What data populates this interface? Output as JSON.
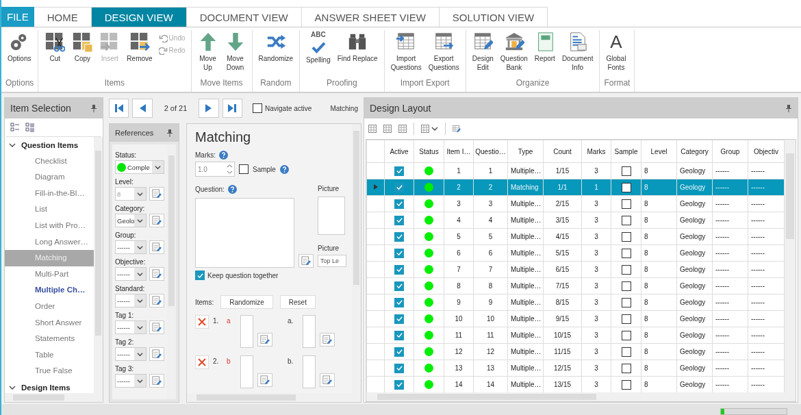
{
  "tabs": [
    {
      "label": "FILE",
      "kind": "file",
      "selected": false
    },
    {
      "label": "HOME",
      "kind": "tab",
      "selected": false
    },
    {
      "label": "DESIGN VIEW",
      "kind": "tab",
      "selected": true
    },
    {
      "label": "DOCUMENT VIEW",
      "kind": "tab",
      "selected": false
    },
    {
      "label": "ANSWER SHEET VIEW",
      "kind": "tab",
      "selected": false
    },
    {
      "label": "SOLUTION VIEW",
      "kind": "tab",
      "selected": false
    }
  ],
  "ribbon": {
    "groups": [
      {
        "label": "Options",
        "buttons": [
          {
            "label": "Options",
            "kind": "large",
            "disabled": false
          }
        ]
      },
      {
        "label": "Items",
        "buttons": [
          {
            "label": "Cut",
            "kind": "large",
            "disabled": false
          },
          {
            "label": "Copy",
            "kind": "large",
            "disabled": false
          },
          {
            "label": "Insert",
            "kind": "large",
            "disabled": true
          },
          {
            "label": "Remove",
            "kind": "large",
            "disabled": false
          },
          {
            "label": "Undo",
            "kind": "small",
            "disabled": true
          },
          {
            "label": "Redo",
            "kind": "small",
            "disabled": true
          }
        ]
      },
      {
        "label": "Move Items",
        "buttons": [
          {
            "label": "Move\nUp",
            "kind": "large",
            "disabled": false
          },
          {
            "label": "Move\nDown",
            "kind": "large",
            "disabled": false
          }
        ]
      },
      {
        "label": "Random",
        "buttons": [
          {
            "label": "Randomize",
            "kind": "large",
            "disabled": false
          }
        ]
      },
      {
        "label": "Proofing",
        "buttons": [
          {
            "label": "Spelling",
            "kind": "large",
            "disabled": false,
            "icon_text": "ABC"
          },
          {
            "label": "Find Replace",
            "kind": "large",
            "disabled": false
          }
        ]
      },
      {
        "label": "Import Export",
        "buttons": [
          {
            "label": "Import\nQuestions",
            "kind": "large",
            "disabled": false
          },
          {
            "label": "Export\nQuestions",
            "kind": "large",
            "disabled": false
          }
        ]
      },
      {
        "label": "Organize",
        "buttons": [
          {
            "label": "Design\nEdit",
            "kind": "large",
            "disabled": false
          },
          {
            "label": "Question\nBank",
            "kind": "large",
            "disabled": false
          },
          {
            "label": "Report",
            "kind": "large",
            "disabled": false
          },
          {
            "label": "Document\nInfo",
            "kind": "large",
            "disabled": false
          }
        ]
      },
      {
        "label": "Format",
        "buttons": [
          {
            "label": "Global\nFonts",
            "kind": "large",
            "disabled": false,
            "icon_text": "A"
          }
        ]
      }
    ]
  },
  "item_selection": {
    "title": "Item Selection",
    "tree": [
      {
        "label": "Question Items",
        "expanded": true,
        "children": [
          {
            "label": "Checklist",
            "selected": false,
            "current": false
          },
          {
            "label": "Diagram",
            "selected": false,
            "current": false
          },
          {
            "label": "Fill-in-the-Bl…",
            "selected": false,
            "current": false
          },
          {
            "label": "List",
            "selected": false,
            "current": false
          },
          {
            "label": "List with Pro…",
            "selected": false,
            "current": false
          },
          {
            "label": "Long Answer…",
            "selected": false,
            "current": false
          },
          {
            "label": "Matching",
            "selected": true,
            "current": false
          },
          {
            "label": "Multi-Part",
            "selected": false,
            "current": false
          },
          {
            "label": "Multiple Ch…",
            "selected": false,
            "current": true
          },
          {
            "label": "Order",
            "selected": false,
            "current": false
          },
          {
            "label": "Short Answer",
            "selected": false,
            "current": false
          },
          {
            "label": "Statements",
            "selected": false,
            "current": false
          },
          {
            "label": "Table",
            "selected": false,
            "current": false
          },
          {
            "label": "True False",
            "selected": false,
            "current": false
          }
        ]
      },
      {
        "label": "Design Items",
        "expanded": true
      }
    ]
  },
  "navigator": {
    "position": "2 of 21",
    "navigate_active": {
      "label": "Navigate active",
      "checked": false
    },
    "item_type": "Matching"
  },
  "references": {
    "title": "References",
    "fields": [
      {
        "label": "Status:",
        "value": "Comple",
        "kind": "status",
        "color": "#00e400",
        "disabled": false
      },
      {
        "label": "Level:",
        "value": "8",
        "kind": "select",
        "disabled": true
      },
      {
        "label": "Category:",
        "value": "Geolo",
        "kind": "select",
        "disabled": false
      },
      {
        "label": "Group:",
        "value": "------",
        "kind": "select",
        "disabled": false
      },
      {
        "label": "Objective:",
        "value": "------",
        "kind": "select",
        "disabled": false
      },
      {
        "label": "Standard:",
        "value": "------",
        "kind": "select",
        "disabled": false
      },
      {
        "label": "Tag 1:",
        "value": "------",
        "kind": "select",
        "disabled": false
      },
      {
        "label": "Tag 2:",
        "value": "------",
        "kind": "select",
        "disabled": false
      },
      {
        "label": "Tag 3:",
        "value": "------",
        "kind": "select",
        "disabled": false
      }
    ]
  },
  "editor": {
    "title": "Matching",
    "marks_label": "Marks:",
    "marks_value": "1.0",
    "sample": {
      "label": "Sample",
      "checked": false
    },
    "question_label": "Question:",
    "picture_label": "Picture",
    "picture_position_label": "Picture",
    "picture_position_value": "Top Le",
    "keep_together": {
      "label": "Keep question together",
      "checked": true
    },
    "items_label": "Items:",
    "buttons": [
      "Randomize",
      "Reset"
    ],
    "items": [
      {
        "number": "1.",
        "letter": "a",
        "match_letter": "a."
      },
      {
        "number": "2.",
        "letter": "b",
        "match_letter": "b."
      }
    ]
  },
  "design_layout": {
    "title": "Design Layout",
    "columns": [
      "Active",
      "Status",
      "Item I…",
      "Questio…",
      "Type",
      "Count",
      "Marks",
      "Sample",
      "Level",
      "Category",
      "Group",
      "Objectiv"
    ],
    "rows": [
      {
        "selected": false,
        "active": true,
        "color": "#00ee00",
        "item": "1",
        "question": "1",
        "type": "Multiple…",
        "count": "1/15",
        "marks": "3",
        "sample": false,
        "level": "8",
        "category": "Geology",
        "group": "------",
        "objective": "------"
      },
      {
        "selected": true,
        "active": true,
        "color": "#00ee00",
        "item": "2",
        "question": "2",
        "type": "Matching",
        "count": "1/1",
        "marks": "1",
        "sample": false,
        "level": "8",
        "category": "Geology",
        "group": "------",
        "objective": "------"
      },
      {
        "selected": false,
        "active": true,
        "color": "#00ee00",
        "item": "3",
        "question": "3",
        "type": "Multiple…",
        "count": "2/15",
        "marks": "3",
        "sample": false,
        "level": "8",
        "category": "Geology",
        "group": "------",
        "objective": "------"
      },
      {
        "selected": false,
        "active": true,
        "color": "#00ee00",
        "item": "4",
        "question": "4",
        "type": "Multiple…",
        "count": "3/15",
        "marks": "3",
        "sample": false,
        "level": "8",
        "category": "Geology",
        "group": "------",
        "objective": "------"
      },
      {
        "selected": false,
        "active": true,
        "color": "#00ee00",
        "item": "5",
        "question": "5",
        "type": "Multiple…",
        "count": "4/15",
        "marks": "3",
        "sample": false,
        "level": "8",
        "category": "Geology",
        "group": "------",
        "objective": "------"
      },
      {
        "selected": false,
        "active": true,
        "color": "#00ee00",
        "item": "6",
        "question": "6",
        "type": "Multiple…",
        "count": "5/15",
        "marks": "3",
        "sample": false,
        "level": "8",
        "category": "Geology",
        "group": "------",
        "objective": "------"
      },
      {
        "selected": false,
        "active": true,
        "color": "#00ee00",
        "item": "7",
        "question": "7",
        "type": "Multiple…",
        "count": "6/15",
        "marks": "3",
        "sample": false,
        "level": "8",
        "category": "Geology",
        "group": "------",
        "objective": "------"
      },
      {
        "selected": false,
        "active": true,
        "color": "#00ee00",
        "item": "8",
        "question": "8",
        "type": "Multiple…",
        "count": "7/15",
        "marks": "3",
        "sample": false,
        "level": "8",
        "category": "Geology",
        "group": "------",
        "objective": "------"
      },
      {
        "selected": false,
        "active": true,
        "color": "#00ee00",
        "item": "9",
        "question": "9",
        "type": "Multiple…",
        "count": "8/15",
        "marks": "3",
        "sample": false,
        "level": "8",
        "category": "Geology",
        "group": "------",
        "objective": "------"
      },
      {
        "selected": false,
        "active": true,
        "color": "#00ee00",
        "item": "10",
        "question": "10",
        "type": "Multiple…",
        "count": "9/15",
        "marks": "3",
        "sample": false,
        "level": "8",
        "category": "Geology",
        "group": "------",
        "objective": "------"
      },
      {
        "selected": false,
        "active": true,
        "color": "#00ee00",
        "item": "11",
        "question": "11",
        "type": "Multiple…",
        "count": "10/15",
        "marks": "3",
        "sample": false,
        "level": "8",
        "category": "Geology",
        "group": "------",
        "objective": "------"
      },
      {
        "selected": false,
        "active": true,
        "color": "#00ee00",
        "item": "12",
        "question": "12",
        "type": "Multiple…",
        "count": "11/15",
        "marks": "3",
        "sample": false,
        "level": "8",
        "category": "Geology",
        "group": "------",
        "objective": "------"
      },
      {
        "selected": false,
        "active": true,
        "color": "#00ee00",
        "item": "13",
        "question": "13",
        "type": "Multiple…",
        "count": "12/15",
        "marks": "3",
        "sample": false,
        "level": "8",
        "category": "Geology",
        "group": "------",
        "objective": "------"
      },
      {
        "selected": false,
        "active": true,
        "color": "#00ee00",
        "item": "14",
        "question": "14",
        "type": "Multiple…",
        "count": "13/15",
        "marks": "3",
        "sample": false,
        "level": "8",
        "category": "Geology",
        "group": "------",
        "objective": "------"
      }
    ]
  },
  "status_bar": {
    "progress": {
      "level": 0.05
    }
  }
}
